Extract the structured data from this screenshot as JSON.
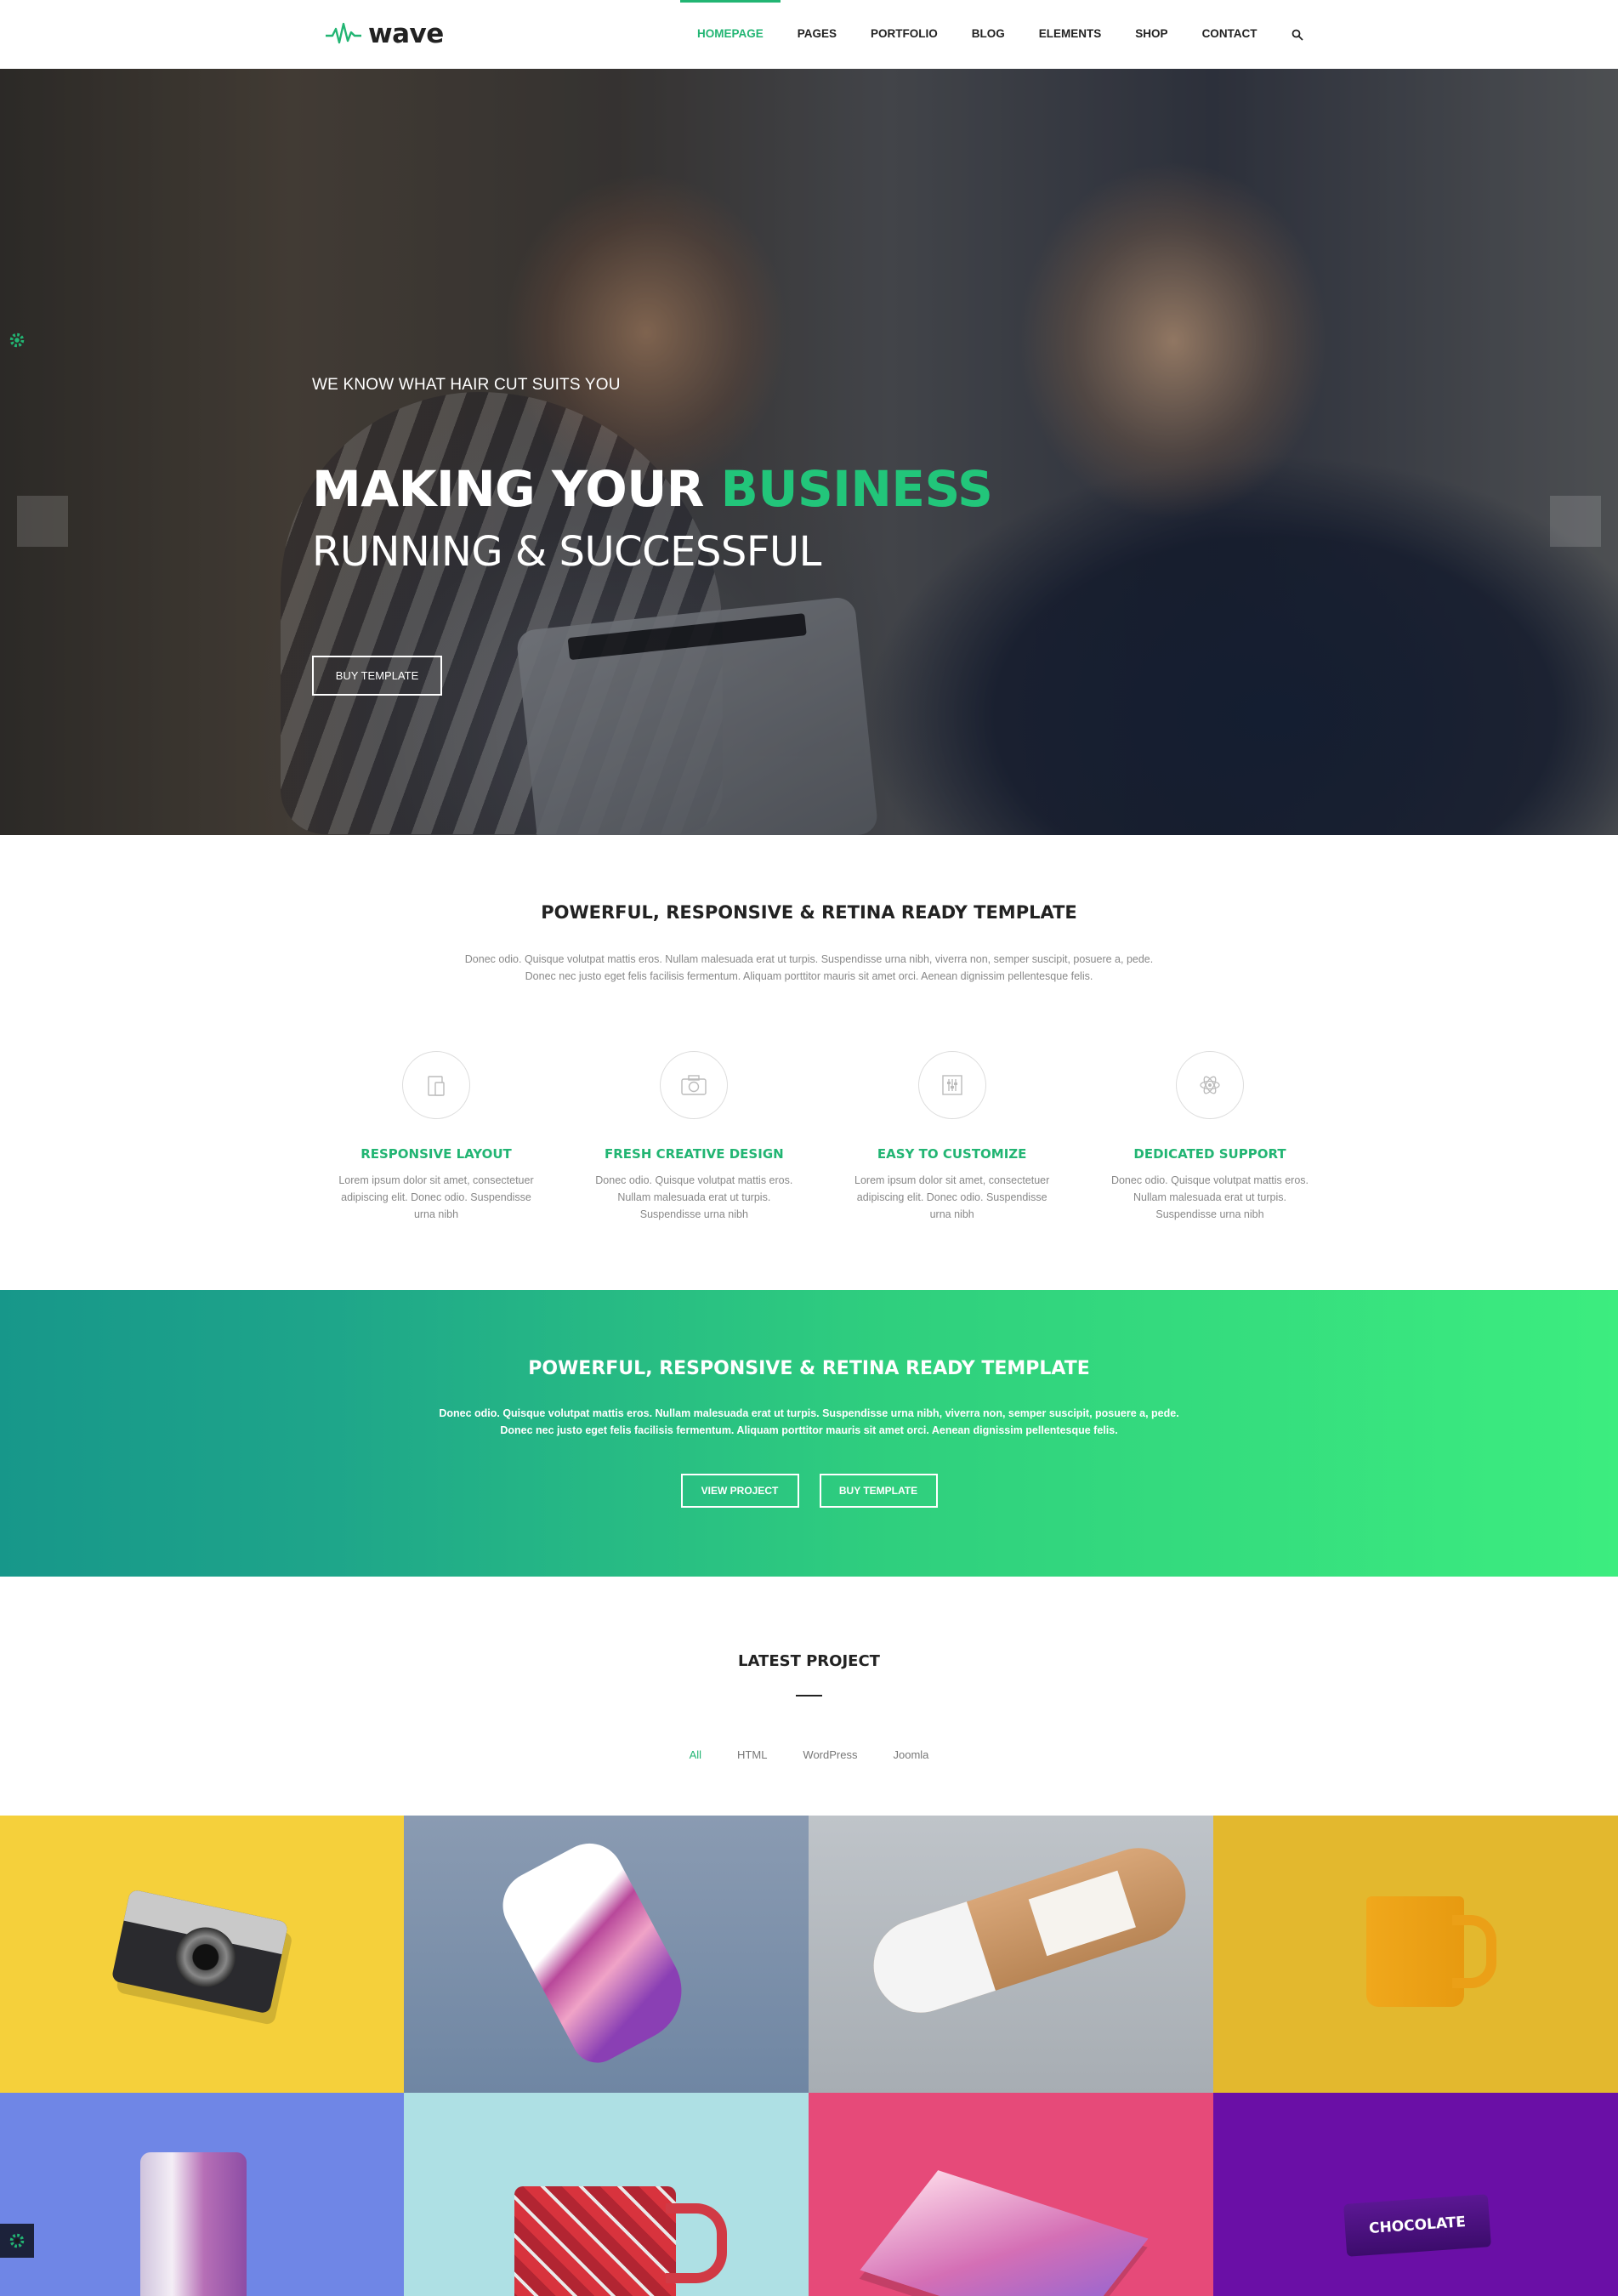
{
  "header": {
    "logo_text": "wave",
    "nav": [
      "HOMEPAGE",
      "PAGES",
      "PORTFOLIO",
      "BLOG",
      "ELEMENTS",
      "SHOP",
      "CONTACT"
    ],
    "active_nav": "HOMEPAGE",
    "search_icon": "search-icon"
  },
  "hero": {
    "kicker": "WE KNOW WHAT HAIR CUT SUITS YOU",
    "title_main": "MAKING YOUR ",
    "title_accent": "BUSINESS",
    "subtitle": "RUNNING & SUCCESSFUL",
    "button": "BUY TEMPLATE"
  },
  "intro": {
    "title": "POWERFUL, RESPONSIVE & RETINA READY TEMPLATE",
    "desc_line1": "Donec odio. Quisque volutpat mattis eros. Nullam malesuada erat ut turpis. Suspendisse urna nibh, viverra non, semper suscipit, posuere a, pede.",
    "desc_line2": "Donec nec justo eget felis facilisis fermentum. Aliquam porttitor mauris sit amet orci. Aenean dignissim pellentesque felis."
  },
  "features": [
    {
      "title": "RESPONSIVE LAYOUT",
      "desc": "Lorem ipsum dolor sit amet, consectetuer adipiscing elit. Donec odio. Suspendisse urna nibh",
      "icon": "devices-icon"
    },
    {
      "title": "FRESH CREATIVE DESIGN",
      "desc": "Donec odio. Quisque volutpat mattis eros. Nullam malesuada erat ut turpis. Suspendisse urna nibh",
      "icon": "camera-icon"
    },
    {
      "title": "EASY TO CUSTOMIZE",
      "desc": "Lorem ipsum dolor sit amet, consectetuer adipiscing elit. Donec odio. Suspendisse urna nibh",
      "icon": "sliders-icon"
    },
    {
      "title": "DEDICATED SUPPORT",
      "desc": "Donec odio. Quisque volutpat mattis eros. Nullam malesuada erat ut turpis. Suspendisse urna nibh",
      "icon": "atom-icon"
    }
  ],
  "cta": {
    "title": "POWERFUL, RESPONSIVE & RETINA READY TEMPLATE",
    "desc_line1": "Donec odio. Quisque volutpat mattis eros. Nullam malesuada erat ut turpis. Suspendisse urna nibh, viverra non, semper suscipit, posuere a, pede.",
    "desc_line2": "Donec nec justo eget felis facilisis fermentum. Aliquam porttitor mauris sit amet orci. Aenean dignissim pellentesque felis.",
    "btn_view": "VIEW PROJECT",
    "btn_buy": "BUY TEMPLATE"
  },
  "latest": {
    "title": "LATEST PROJECT",
    "filters": [
      "All",
      "HTML",
      "WordPress",
      "Joomla"
    ],
    "active_filter": "All",
    "choc_label": "CHOCOLATE"
  },
  "colors": {
    "accent": "#22b573",
    "cta_gradient_start": "#17978a",
    "cta_gradient_end": "#3ced7f"
  }
}
